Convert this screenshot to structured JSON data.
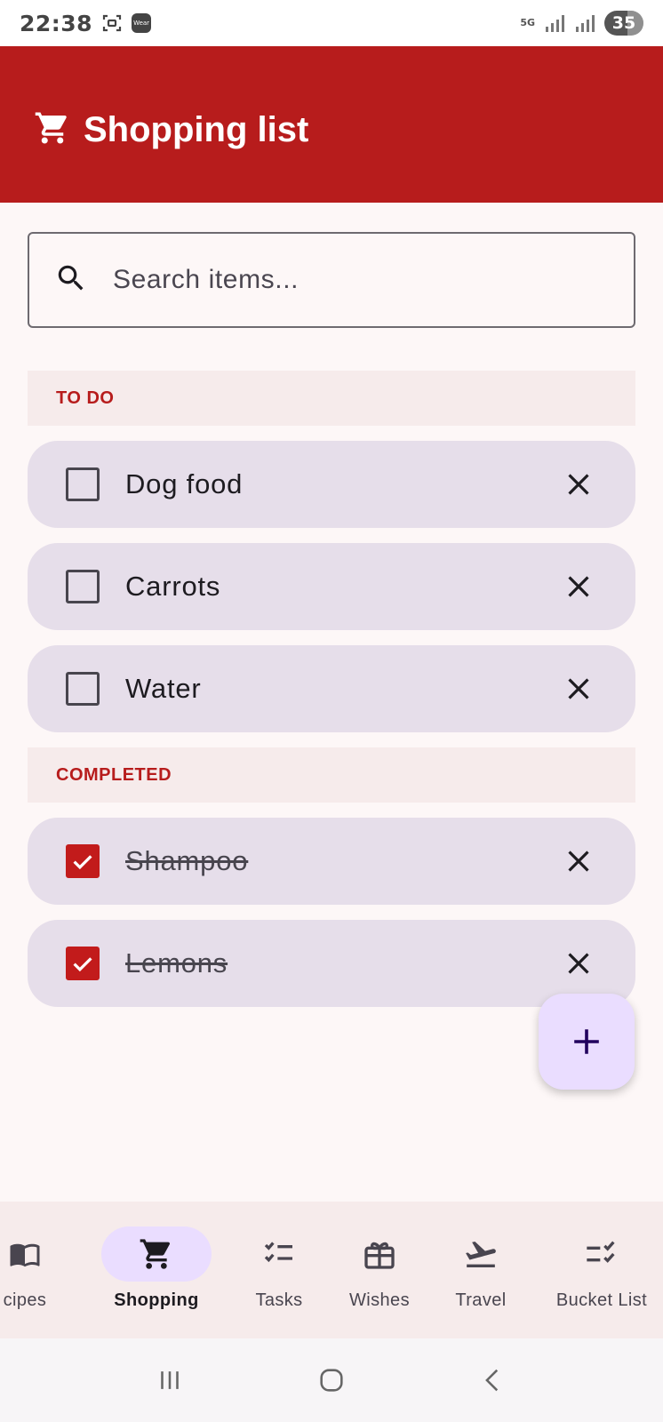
{
  "status_bar": {
    "time": "22:38",
    "wear_label": "Wear",
    "network": "5G",
    "battery": "35"
  },
  "app_bar": {
    "title": "Shopping list",
    "icon": "cart-icon"
  },
  "search": {
    "placeholder": "Search items...",
    "value": ""
  },
  "sections": {
    "todo": {
      "title": "TO DO",
      "items": [
        {
          "label": "Dog food",
          "checked": false
        },
        {
          "label": "Carrots",
          "checked": false
        },
        {
          "label": "Water",
          "checked": false
        }
      ]
    },
    "completed": {
      "title": "COMPLETED",
      "items": [
        {
          "label": "Shampoo",
          "checked": true
        },
        {
          "label": "Lemons",
          "checked": true
        }
      ]
    }
  },
  "fab": {
    "icon": "plus-icon"
  },
  "bottom_nav": {
    "items": [
      {
        "label": "cipes",
        "icon": "book-icon",
        "active": false
      },
      {
        "label": "Shopping",
        "icon": "cart-icon",
        "active": true
      },
      {
        "label": "Tasks",
        "icon": "checklist-icon",
        "active": false
      },
      {
        "label": "Wishes",
        "icon": "gift-icon",
        "active": false
      },
      {
        "label": "Travel",
        "icon": "plane-icon",
        "active": false
      },
      {
        "label": "Bucket List",
        "icon": "bucket-list-icon",
        "active": false
      }
    ]
  },
  "colors": {
    "primary": "#B71C1C",
    "card": "#E6DEEA",
    "section_bg": "#F6EBEB",
    "fab_bg": "#EADDFF",
    "background": "#FDF7F7"
  }
}
